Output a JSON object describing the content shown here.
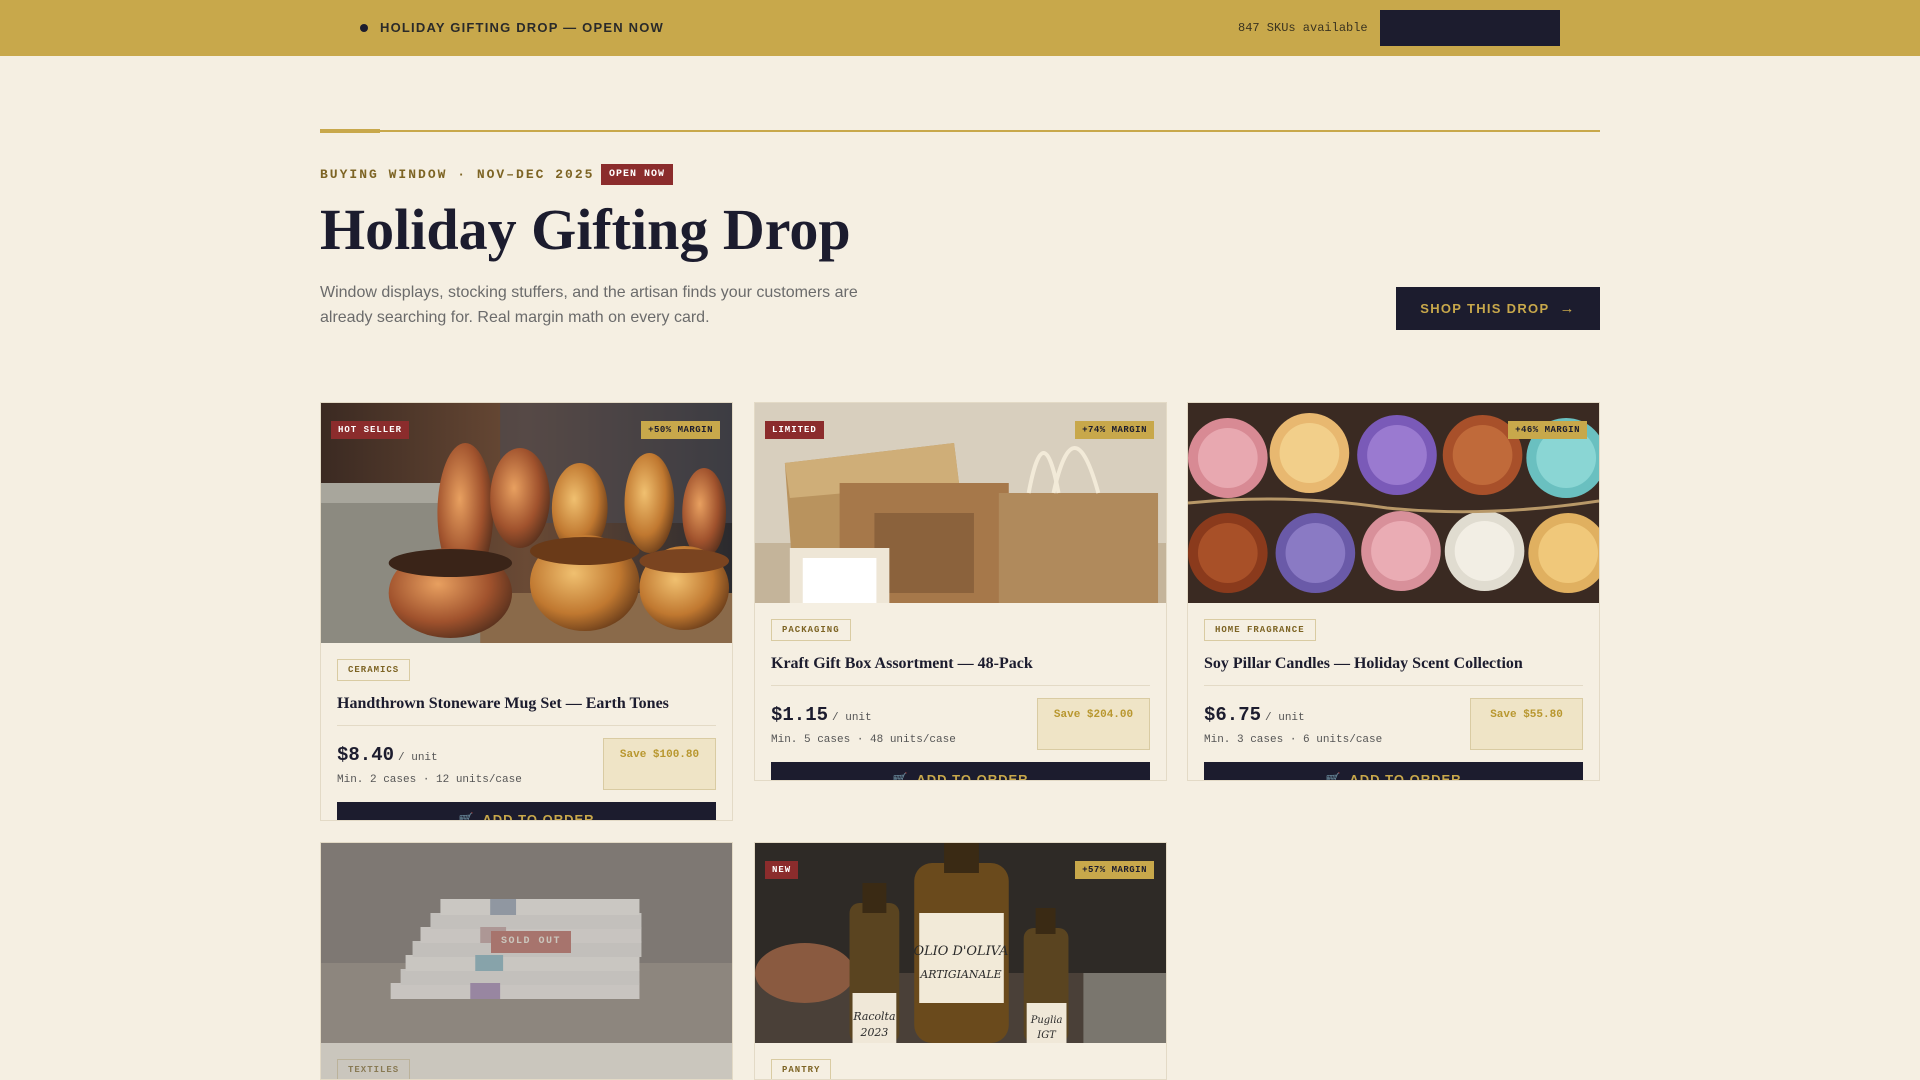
{
  "topbar": {
    "announcement": "HOLIDAY GIFTING DROP — OPEN NOW",
    "sku_count": "847 SKUs available",
    "cta_label": ""
  },
  "hero": {
    "eyebrow": "BUYING WINDOW · NOV–DEC 2025",
    "status_badge": "OPEN NOW",
    "title": "Holiday Gifting Drop",
    "subtitle": "Window displays, stocking stuffers, and the artisan finds your customers are already searching for. Real margin math on every card.",
    "shop_button": "SHOP THIS DROP",
    "shop_icon": "→"
  },
  "products": [
    {
      "badge": "HOT SELLER",
      "margin": "+50% MARGIN",
      "category": "CERAMICS",
      "name": "Handthrown Stoneware Mug Set — Earth Tones",
      "price": "$8.40",
      "unit": "/ unit",
      "min": "Min. 2 cases · 12 units/case",
      "save": "Save $100.80",
      "button": "ADD TO ORDER"
    },
    {
      "badge": "LIMITED",
      "margin": "+74% MARGIN",
      "category": "PACKAGING",
      "name": "Kraft Gift Box Assortment — 48-Pack",
      "price": "$1.15",
      "unit": "/ unit",
      "min": "Min. 5 cases · 48 units/case",
      "save": "Save $204.00",
      "button": "ADD TO ORDER"
    },
    {
      "badge": "",
      "margin": "+46% MARGIN",
      "category": "HOME FRAGRANCE",
      "name": "Soy Pillar Candles — Holiday Scent Collection",
      "price": "$6.75",
      "unit": "/ unit",
      "min": "Min. 3 cases · 6 units/case",
      "save": "Save $55.80",
      "button": "ADD TO ORDER"
    },
    {
      "status": "SOLD OUT",
      "category": "TEXTILES"
    },
    {
      "badge": "NEW",
      "margin": "+57% MARGIN",
      "category": "PANTRY",
      "label_line1": "OLIO D'OLIVA",
      "label_line2": "ARTIGIANALE",
      "label_left1": "Racolta",
      "label_left2": "2023",
      "label_right1": "Puglia",
      "label_right2": "IGT"
    }
  ],
  "icons": {
    "cart": "cart-icon",
    "arrow": "arrow-right-icon"
  },
  "colors": {
    "gold": "#c8a84b",
    "navy": "#1c1c2e",
    "cream": "#f5efe2",
    "red": "#8b2c2c"
  }
}
